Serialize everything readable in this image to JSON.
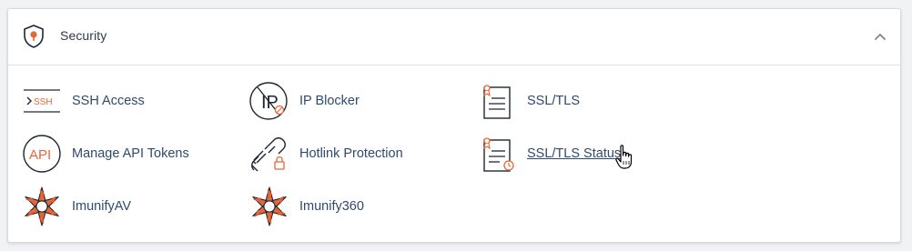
{
  "section": {
    "title": "Security",
    "colors": {
      "accent": "#e96436",
      "label": "#2f4a6d",
      "icon_dark": "#1d2733"
    }
  },
  "items": [
    {
      "label": "SSH Access",
      "icon": "ssh-terminal-icon"
    },
    {
      "label": "IP Blocker",
      "icon": "ip-blocker-icon"
    },
    {
      "label": "SSL/TLS",
      "icon": "certificate-icon"
    },
    {
      "label": "Manage API Tokens",
      "icon": "api-icon"
    },
    {
      "label": "Hotlink Protection",
      "icon": "broken-link-lock-icon"
    },
    {
      "label": "SSL/TLS Status",
      "icon": "certificate-status-icon",
      "hovered": true
    },
    {
      "label": "ImunifyAV",
      "icon": "imunify-av-icon"
    },
    {
      "label": "Imunify360",
      "icon": "imunify360-icon"
    }
  ],
  "ssh_icon_text": "SSH",
  "api_icon_text": "API",
  "ip_icon_text": "IP"
}
